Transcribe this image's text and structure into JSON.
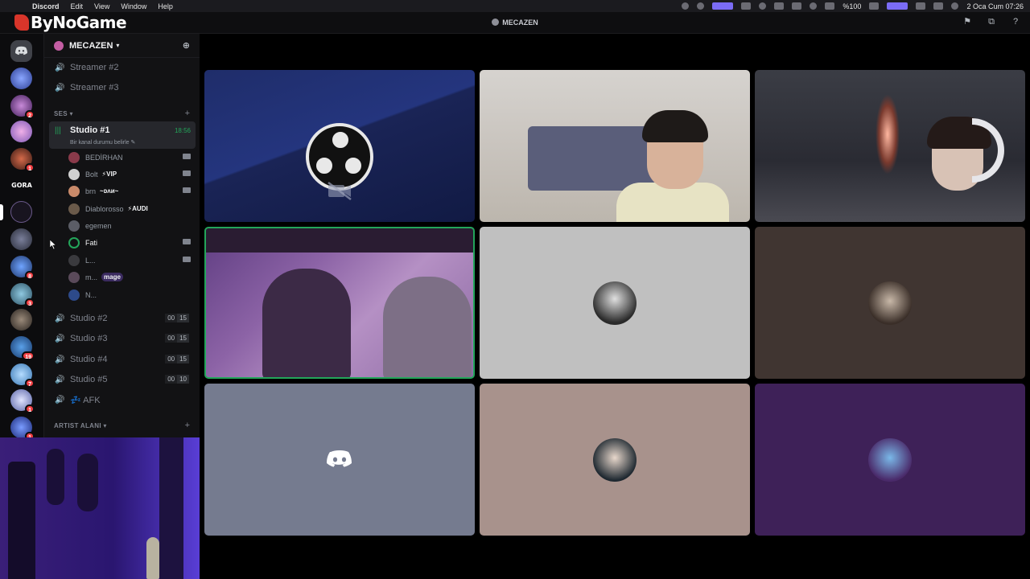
{
  "menubar": {
    "app": "Discord",
    "items": [
      "Edit",
      "View",
      "Window",
      "Help"
    ],
    "battery": "%100",
    "datetime": "2 Oca Cum  07:26"
  },
  "titlebar": {
    "brand": "ByNoGame",
    "server_name": "MECAZEN"
  },
  "rail": {
    "text_server": "GORA",
    "badges": [
      "2",
      "1",
      "8",
      "3",
      "19",
      "7",
      "1",
      "1"
    ]
  },
  "guild": {
    "name": "MECAZEN"
  },
  "channels": {
    "top": [
      {
        "name": "Streamer #2"
      },
      {
        "name": "Streamer #3"
      }
    ],
    "category_ses": "SES",
    "active": {
      "name": "Studio #1",
      "time": "18:56",
      "status": "Bir kanal durumu belirle"
    },
    "users": [
      {
        "name": "BEDİRHAN",
        "tag": ""
      },
      {
        "name": "Bolt",
        "tag": "⚡VIP"
      },
      {
        "name": "brn",
        "tag": "~ᴅʌᴎ~"
      },
      {
        "name": "Diablorosso",
        "tag": "⚡AUDI"
      },
      {
        "name": "egemen",
        "tag": ""
      },
      {
        "name": "Fati",
        "tag": ""
      },
      {
        "name": "L...",
        "tag": ""
      },
      {
        "name": "m...",
        "tag": "mage"
      },
      {
        "name": "N...",
        "tag": ""
      }
    ],
    "others": [
      {
        "name": "Studio #2",
        "a": "00",
        "b": "15"
      },
      {
        "name": "Studio #3",
        "a": "00",
        "b": "15"
      },
      {
        "name": "Studio #4",
        "a": "00",
        "b": "15"
      },
      {
        "name": "Studio #5",
        "a": "00",
        "b": "10"
      },
      {
        "name": "💤 AFK"
      }
    ],
    "category_artist": "ARTIST ALANI"
  },
  "colors": {
    "accent_green": "#23a55a",
    "badge_red": "#f23f43",
    "blurple": "#5865f2"
  }
}
